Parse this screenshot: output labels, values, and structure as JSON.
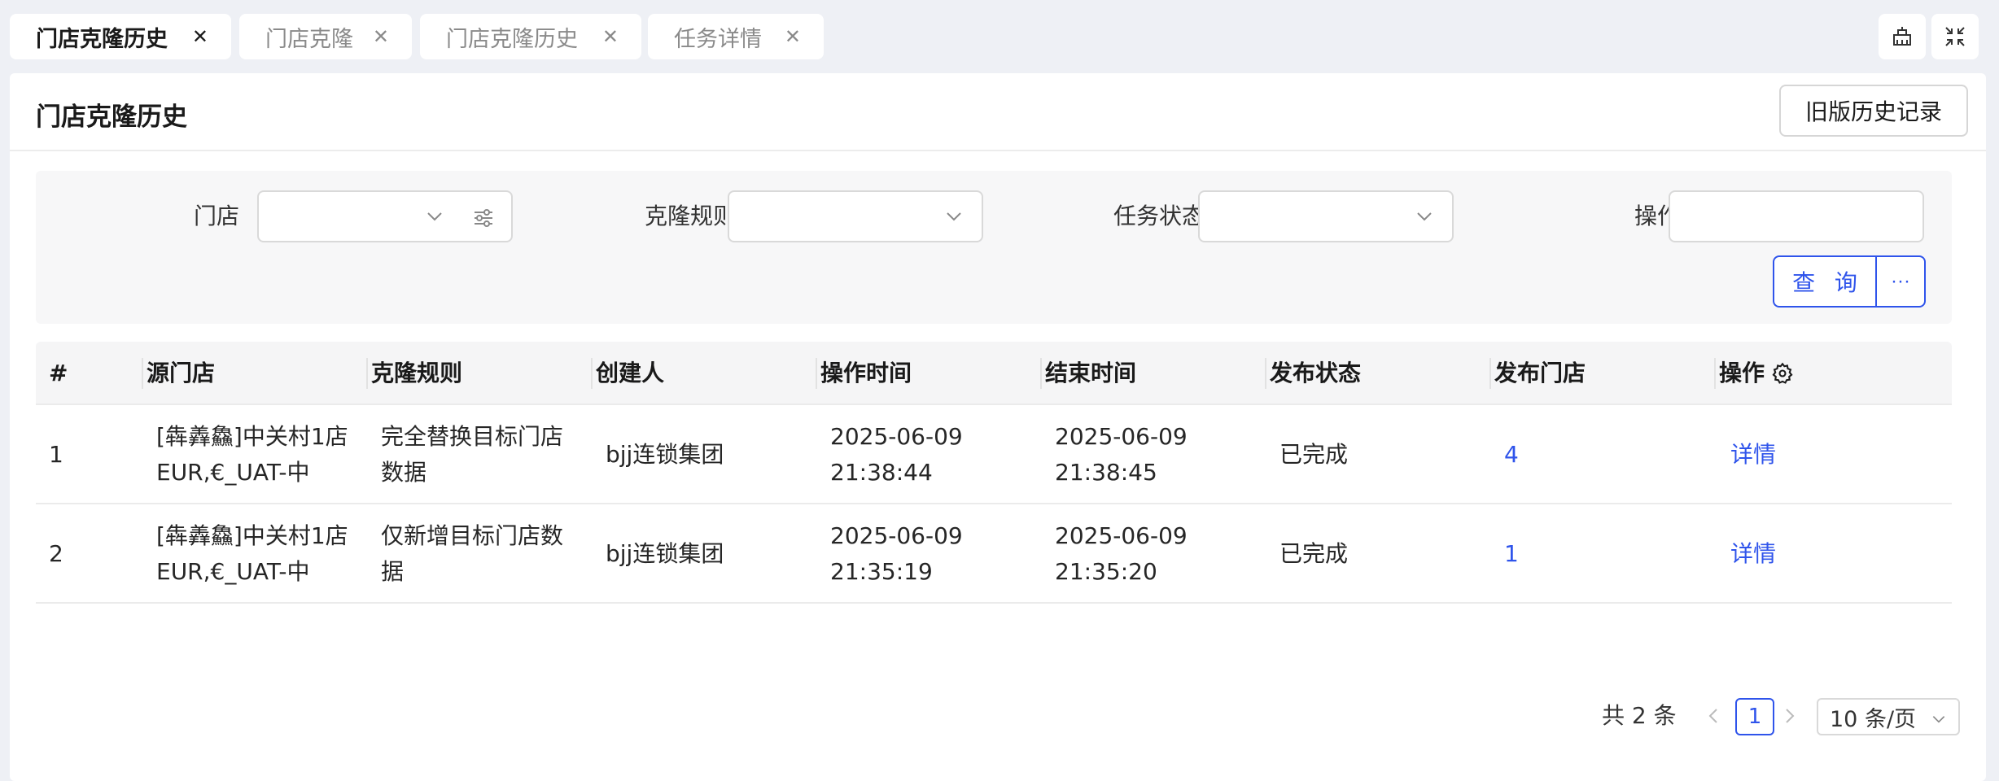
{
  "tabs": [
    {
      "label": "门店克隆历史",
      "active": true
    },
    {
      "label": "门店克隆",
      "active": false
    },
    {
      "label": "门店克隆历史",
      "active": false
    },
    {
      "label": "任务详情",
      "active": false
    }
  ],
  "tab_close_glyph": "✕",
  "toolbar_icons": [
    "home-icon",
    "fullscreen-icon"
  ],
  "page": {
    "title": "门店克隆历史",
    "old_history_button": "旧版历史记录"
  },
  "filters": {
    "store_label": "门店",
    "clone_rule_label": "克隆规则",
    "task_status_label": "任务状态",
    "operation_label": "操作",
    "query_button": "查 询",
    "more_button": "···"
  },
  "table": {
    "headers": [
      "#",
      "源门店",
      "克隆规则",
      "创建人",
      "操作时间",
      "结束时间",
      "发布状态",
      "发布门店",
      "操作"
    ],
    "rows": [
      {
        "index": "1",
        "source_store": [
          "[犇羴鱻]中关村1店",
          "EUR,€_UAT-中"
        ],
        "clone_rule": [
          "完全替换目标门店",
          "数据"
        ],
        "creator": "bjj连锁集团",
        "op_time": [
          "2025-06-09",
          "21:38:44"
        ],
        "end_time": [
          "2025-06-09",
          "21:38:45"
        ],
        "publish_status": "已完成",
        "publish_stores": "4",
        "action": "详情"
      },
      {
        "index": "2",
        "source_store": [
          "[犇羴鱻]中关村1店",
          "EUR,€_UAT-中"
        ],
        "clone_rule": [
          "仅新增目标门店数",
          "据"
        ],
        "creator": "bjj连锁集团",
        "op_time": [
          "2025-06-09",
          "21:35:19"
        ],
        "end_time": [
          "2025-06-09",
          "21:35:20"
        ],
        "publish_status": "已完成",
        "publish_stores": "1",
        "action": "详情"
      }
    ]
  },
  "pagination": {
    "total": "共 2 条",
    "current_page": "1",
    "page_size": "10 条/页"
  },
  "colors": {
    "accent": "#2f54eb",
    "background": "#eef0f5"
  }
}
